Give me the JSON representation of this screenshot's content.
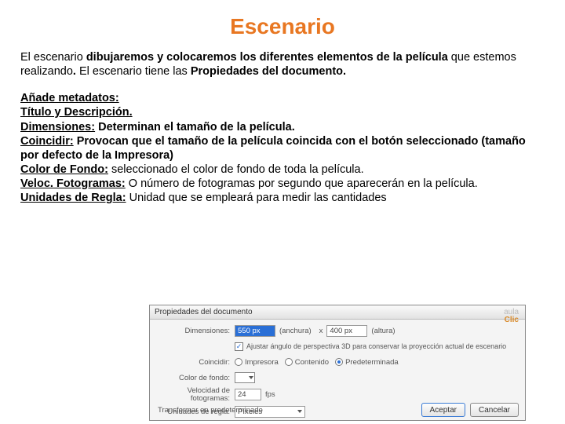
{
  "title": "Escenario",
  "p1_a": "El escenario ",
  "p1_b": "dibujaremos y colocaremos los diferentes elementos de la película",
  "p1_c": " que estemos realizando",
  "p1_d": " El escenario tiene las ",
  "p1_e": "Propiedades del documento.",
  "meta_heading": "Añade metadatos:",
  "meta_line1": "Título y Descripción.",
  "dim_label": "Dimensiones:",
  "dim_text": " Determinan el tamaño de la película.",
  "coin_label": "Coincidir:",
  "coin_text": " Provocan que el tamaño de la película coincida con el botón seleccionado (tamaño por defecto de la Impresora)",
  "bg_label": "Color de Fondo:",
  "bg_text": " seleccionado el color de fondo de toda la película.",
  "fps_label": "Veloc. Fotogramas:",
  "fps_text": " O número de fotogramas por segundo que aparecerán en la película.",
  "ruler_label": "Unidades de Regla:",
  "ruler_text": " Unidad que se empleará para medir las cantidades",
  "dlg": {
    "title": "Propiedades del documento",
    "dim_lbl": "Dimensiones:",
    "dim_w": "550 px",
    "dim_w_hint": "(anchura)",
    "dim_x": "x",
    "dim_h": "400 px",
    "dim_h_hint": "(altura)",
    "adjust_check": "✓",
    "adjust_text": "Ajustar ángulo de perspectiva 3D para conservar la proyección actual de escenario",
    "match_lbl": "Coincidir:",
    "r_print": "Impresora",
    "r_content": "Contenido",
    "r_default": "Predeterminada",
    "bg_lbl": "Color de fondo:",
    "fps_lbl": "Velocidad de\nfotogramas:",
    "fps_val": "24",
    "fps_unit": "fps",
    "ruler_lbl": "Unidades de regla:",
    "ruler_val": "Píxeles",
    "make_default": "Transformar en predeterminado",
    "ok": "Aceptar",
    "cancel": "Cancelar",
    "wm_aula": "aula",
    "wm_clic": "Clic"
  }
}
